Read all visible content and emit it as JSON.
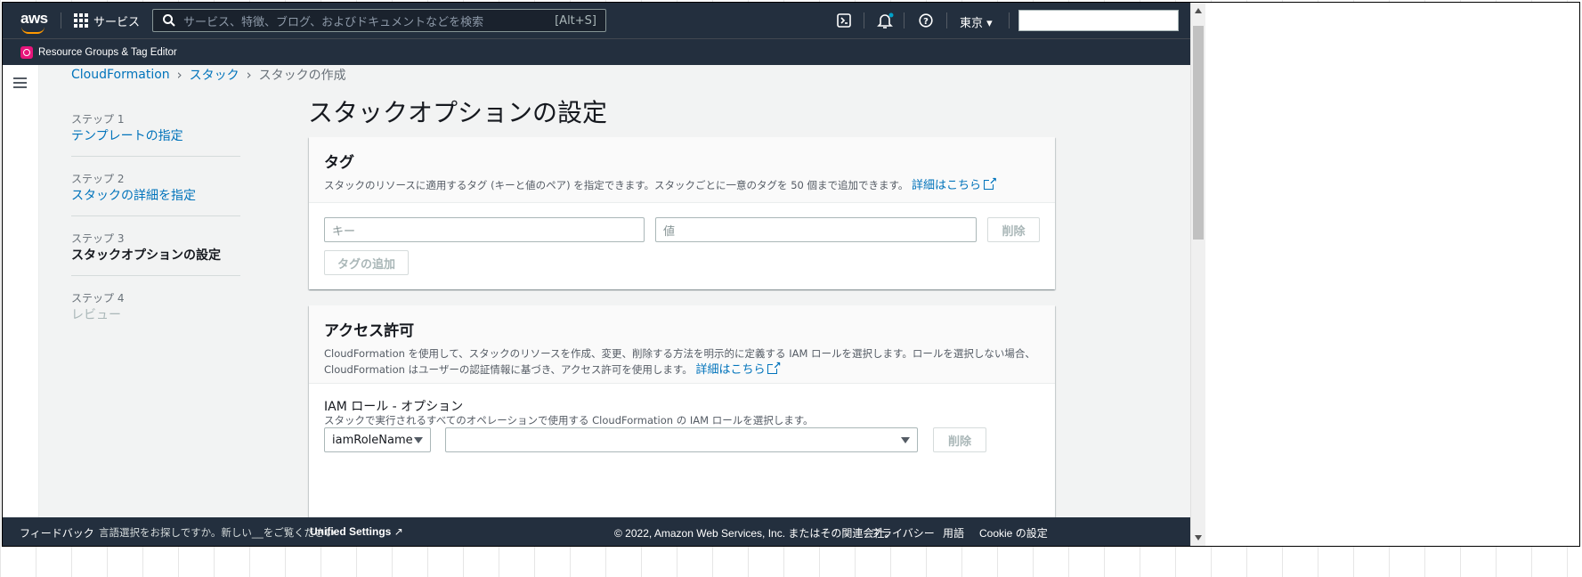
{
  "nav": {
    "logo": "aws",
    "services_label": "サービス",
    "search_placeholder": "サービス、特徴、ブログ、およびドキュメントなどを検索",
    "search_shortcut": "[Alt+S]",
    "region": "東京 ▾",
    "icons": [
      "grid-icon",
      "search-icon",
      "cloudshell-icon",
      "bell-icon",
      "help-icon"
    ]
  },
  "subnav": {
    "label": "Resource Groups & Tag Editor"
  },
  "breadcrumb": {
    "items": [
      "CloudFormation",
      "スタック"
    ],
    "current": "スタックの作成"
  },
  "steps": [
    {
      "num": "ステップ 1",
      "name": "テンプレートの指定",
      "state": "link"
    },
    {
      "num": "ステップ 2",
      "name": "スタックの詳細を指定",
      "state": "link"
    },
    {
      "num": "ステップ 3",
      "name": "スタックオプションの設定",
      "state": "active"
    },
    {
      "num": "ステップ 4",
      "name": "レビュー",
      "state": "disabled"
    }
  ],
  "page_title": "スタックオプションの設定",
  "tags_panel": {
    "title": "タグ",
    "description": "スタックのリソースに適用するタグ (キーと値のペア) を指定できます。スタックごとに一意のタグを 50 個まで追加できます。",
    "learn_more": "詳細はこちら",
    "key_placeholder": "キー",
    "value_placeholder": "値",
    "remove_label": "削除",
    "add_tag_label": "タグの追加"
  },
  "permissions_panel": {
    "title": "アクセス許可",
    "description": "CloudFormation を使用して、スタックのリソースを作成、変更、削除する方法を明示的に定義する IAM ロールを選択します。ロールを選択しない場合、CloudFormation はユーザーの認証情報に基づき、アクセス許可を使用します。",
    "learn_more": "詳細はこちら",
    "iam_label": "IAM ロール - オプション",
    "iam_desc": "スタックで実行されるすべてのオペレーションで使用する CloudFormation の IAM ロールを選択します。",
    "select_value": "iamRoleName",
    "role_value": "",
    "remove_label": "削除"
  },
  "footer": {
    "feedback": "フィードバック",
    "lang_text": "言語選択をお探しですか。新しい__をご覧ください",
    "unified": "Unified Settings",
    "copyright": "© 2022, Amazon Web Services, Inc. またはその関連会社。",
    "privacy": "プライバシー",
    "terms": "用語",
    "cookie": "Cookie の設定"
  },
  "colors": {
    "nav_bg": "#232f3e",
    "link": "#0073bb",
    "accent": "#ff9900",
    "notify_dot": "#00a1c9"
  }
}
